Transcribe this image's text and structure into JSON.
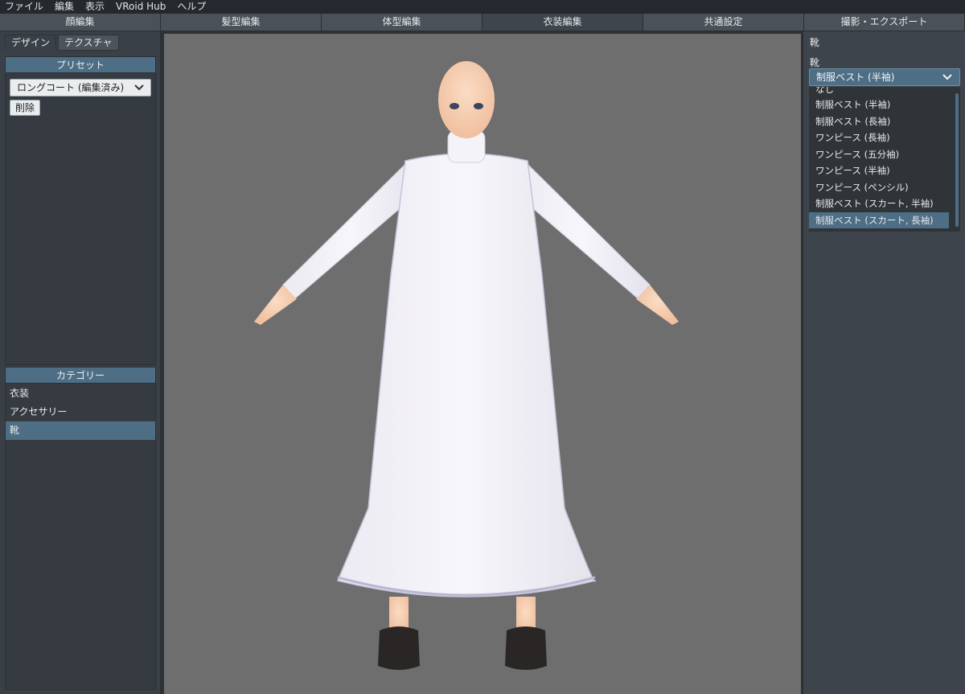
{
  "menu": [
    "ファイル",
    "編集",
    "表示",
    "VRoid Hub",
    "ヘルプ"
  ],
  "main_tabs": [
    "顔編集",
    "髪型編集",
    "体型編集",
    "衣装編集",
    "共通設定",
    "撮影・エクスポート"
  ],
  "active_main_tab": 3,
  "sub_tabs": [
    "デザイン",
    "テクスチャ"
  ],
  "preset": {
    "header": "プリセット",
    "selected": "ロングコート (編集済み)",
    "delete_label": "削除"
  },
  "category": {
    "header": "カテゴリー",
    "items": [
      "衣装",
      "アクセサリー",
      "靴"
    ],
    "selected_index": 2
  },
  "right": {
    "title": "靴",
    "label": "靴",
    "selected": "制服ベスト (半袖)",
    "options": [
      "なし",
      "制服ベスト (半袖)",
      "制服ベスト (長袖)",
      "ワンピース (長袖)",
      "ワンピース (五分袖)",
      "ワンピース (半袖)",
      "ワンピース (ペンシル)",
      "制服ベスト (スカート, 半袖)",
      "制服ベスト (スカート, 長袖)"
    ],
    "highlighted_index": 8
  },
  "icons": {
    "chevron": "chevron-down-icon"
  },
  "colors": {
    "accent": "#4e6e85",
    "viewport_bg": "#6e6e6e",
    "panel_bg": "#3a4047"
  }
}
